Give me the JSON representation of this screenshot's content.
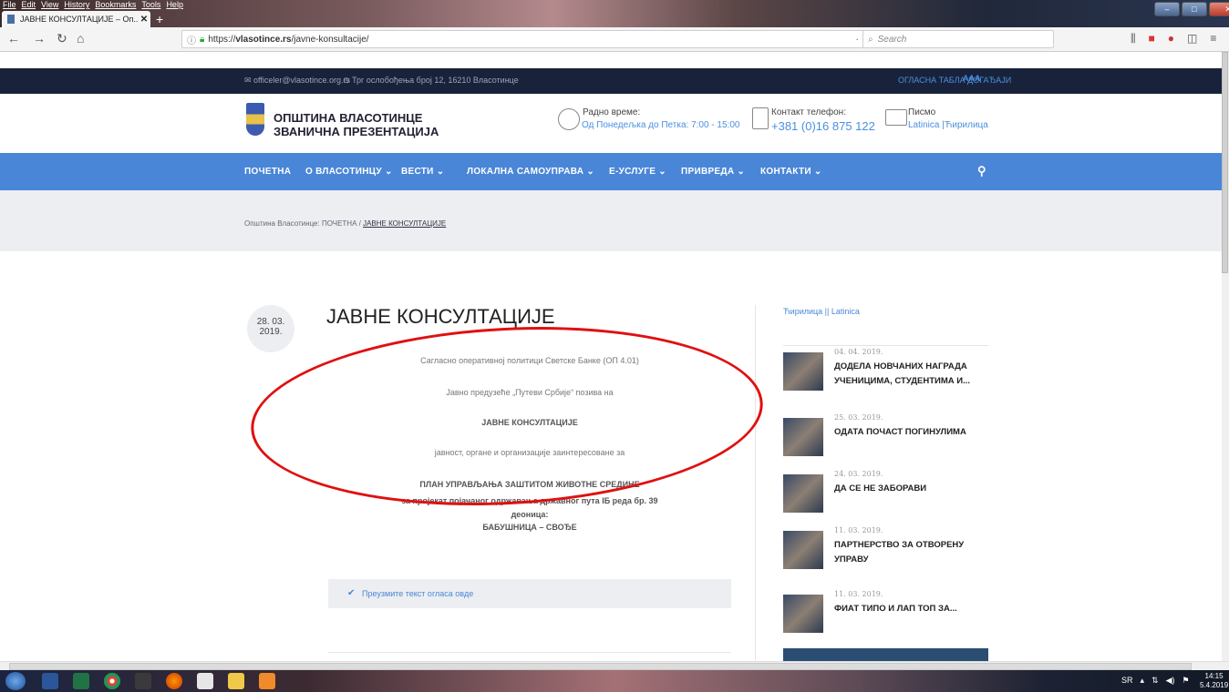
{
  "browser": {
    "menu": [
      "File",
      "Edit",
      "View",
      "History",
      "Bookmarks",
      "Tools",
      "Help"
    ],
    "tab_title": "ЈАВНЕ КОНСУЛТАЦИЈЕ – Оп...",
    "url_prefix": "https://",
    "url_host": "vlasotince.rs",
    "url_path": "/javne-konsultacije/",
    "url_tools": "··· ♡ ☆",
    "search_placeholder": "Search"
  },
  "topbar": {
    "email": "officeler@vlasotince.org.rs",
    "address": "Трг ослобођења број 12, 16210 Власотинце",
    "links": "ОГЛАСНА ТАБЛА   ДОГАЂАЈИ",
    "font_sizes": "AAA"
  },
  "header": {
    "logo_line1": "ОПШТИНА ВЛАСОТИНЦЕ",
    "logo_line2": "ЗВАНИЧНА ПРЕЗЕНТАЦИЈА",
    "hours_label": "Радно време:",
    "hours_value": "Од Понедељка до Петка: 7:00 - 15:00",
    "phone_label": "Контакт телефон:",
    "phone_value": "+381 (0)16 875 122",
    "script_label": "Писмо",
    "script_value": "Latinica |Ћирилица"
  },
  "nav": {
    "items": [
      "ПОЧЕТНА",
      "О ВЛАСОТИНЦУ ⌄",
      "ВЕСТИ ⌄",
      "ЛОКАЛНА САМОУПРАВА ⌄",
      "Е-УСЛУГЕ ⌄",
      "ПРИВРЕДА ⌄",
      "КОНТАКТИ ⌄"
    ]
  },
  "breadcrumb": {
    "prefix": "Општина Власотинце:  ПОЧЕТНА  / ",
    "current": "ЈАВНЕ КОНСУЛТАЦИЈЕ"
  },
  "article": {
    "date_day": "28. 03.",
    "date_year": "2019.",
    "title": "ЈАВНЕ КОНСУЛТАЦИЈЕ",
    "lines": [
      "Сагласно оперативној политици Светске Банке (ОП 4.01)",
      "Јавно предузеће „Путеви Србије“ позива на",
      "ЈАВНЕ КОНСУЛТАЦИЈЕ",
      "јавност, органе и организације заинтересоване за",
      "ПЛАН УПРАВЉАЊА ЗАШТИТОМ ЖИВОТНЕ СРЕДИНЕ",
      "за пројекат појачаног одржавања државног пута IБ реда бр. 39",
      "деоница:",
      "БАБУШНИЦА – СВОЂЕ"
    ],
    "download_label": "Преузмите текст огласа овде"
  },
  "sidebar": {
    "script_toggle": "Ћирилица || Latinica",
    "news": [
      {
        "date": "04. 04. 2019.",
        "title": "ДОДЕЛА НОВЧАНИХ НАГРАДА УЧЕНИЦИМА, СТУДЕНТИМА И..."
      },
      {
        "date": "25. 03. 2019.",
        "title": "ОДАТА ПОЧАСТ ПОГИНУЛИМА"
      },
      {
        "date": "24. 03. 2019.",
        "title": "ДА СЕ НЕ ЗАБОРАВИ"
      },
      {
        "date": "11. 03. 2019.",
        "title": "ПАРТНЕРСТВО ЗА ОТВОРЕНУ УПРАВУ"
      },
      {
        "date": "11. 03. 2019.",
        "title": "ФИАТ ТИПО И ЛАП ТОП ЗА..."
      }
    ]
  },
  "taskbar": {
    "lang": "SR",
    "time": "14:15",
    "date": "5.4.2019"
  },
  "colors": {
    "nav_blue": "#4a86d8",
    "topbar_dark": "#18233b",
    "annotation_red": "#e01010"
  }
}
